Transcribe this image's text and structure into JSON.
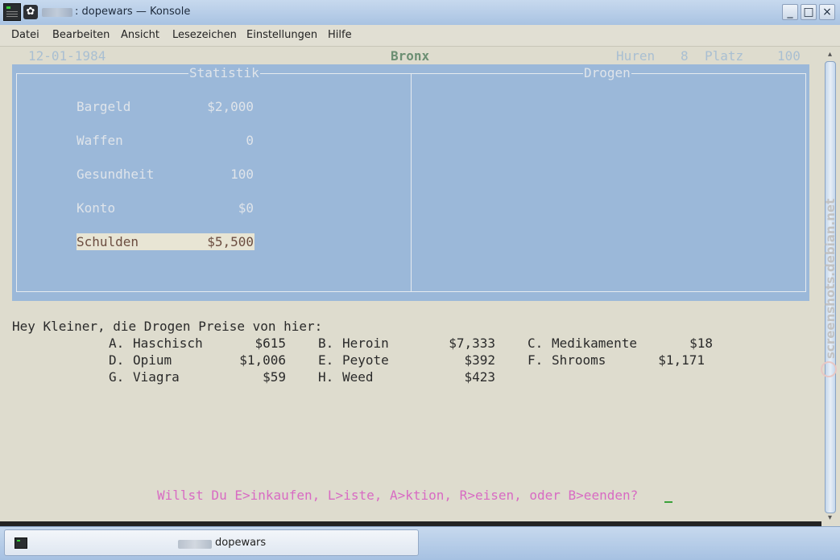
{
  "window": {
    "title": ": dopewars — Konsole",
    "buttons": {
      "minimize": "_",
      "maximize": "□",
      "close": "×"
    }
  },
  "menu": [
    "Datei",
    "Bearbeiten",
    "Ansicht",
    "Lesezeichen",
    "Einstellungen",
    "Hilfe"
  ],
  "game": {
    "date": "12-01-1984",
    "location": "Bronx",
    "huren_label": "Huren",
    "huren_value": "8",
    "platz_label": "Platz",
    "platz_value": "100",
    "stats_title": "Statistik",
    "drugs_title": "Drogen",
    "stats": [
      {
        "label": "Bargeld",
        "value": "$2,000"
      },
      {
        "label": "Waffen",
        "value": "0"
      },
      {
        "label": "Gesundheit",
        "value": "100"
      },
      {
        "label": "Konto",
        "value": "$0"
      },
      {
        "label": "Schulden",
        "value": "$5,500",
        "highlighted": true
      }
    ],
    "price_intro": "Hey Kleiner, die Drogen Preise von hier:",
    "prices": [
      {
        "code": "A.",
        "name": "Haschisch",
        "price": "$615"
      },
      {
        "code": "B.",
        "name": "Heroin",
        "price": "$7,333"
      },
      {
        "code": "C.",
        "name": "Medikamente",
        "price": "$18"
      },
      {
        "code": "D.",
        "name": "Opium",
        "price": "$1,006"
      },
      {
        "code": "E.",
        "name": "Peyote",
        "price": "$392"
      },
      {
        "code": "F.",
        "name": "Shrooms",
        "price": "$1,171"
      },
      {
        "code": "G.",
        "name": "Viagra",
        "price": "$59"
      },
      {
        "code": "H.",
        "name": "Weed",
        "price": "$423"
      }
    ],
    "prompt": "Willst Du E>inkaufen, L>iste, A>ktion, R>eisen, oder B>eenden?"
  },
  "watermark": "screenshots.debian.net",
  "taskbar": {
    "label": "dopewars"
  },
  "colors": {
    "panel": "#9bb8d9",
    "terminal_bg": "#dedcce",
    "prompt": "#d86bc3",
    "location": "#6c8f73"
  }
}
